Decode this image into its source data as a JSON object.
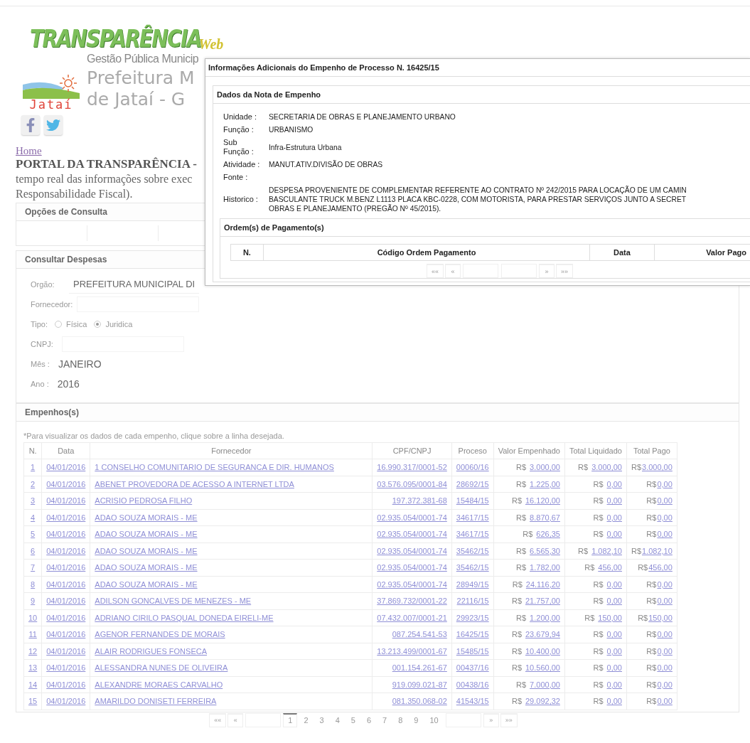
{
  "header": {
    "logo_title": "TRANSPARÊNCIA",
    "logo_suffix": "Web",
    "subtitle": "Gestão Pública Municip",
    "city_logo_text": "Jataí",
    "city_line1": "Prefeitura M",
    "city_line2": "de Jataí - G"
  },
  "home_link": "Home",
  "intro": {
    "title": "PORTAL DA TRANSPARÊNCIA -",
    "line2": "tempo real das informações sobre exec",
    "line3": "Responsabilidade Fiscal)."
  },
  "options_panel": {
    "title": "Opções de Consulta"
  },
  "query_panel": {
    "title": "Consultar Despesas",
    "fields": [
      {
        "kind": "select",
        "label": "Orgão:",
        "value": "PREFEITURA MUNICIPAL DI"
      },
      {
        "kind": "input",
        "label": "Fornecedor:"
      },
      {
        "kind": "radio",
        "label": "Tipo:",
        "options": [
          {
            "label": "Física",
            "selected": false
          },
          {
            "label": "Juridica",
            "selected": true
          }
        ]
      },
      {
        "kind": "input",
        "label": "CNPJ:"
      },
      {
        "kind": "text",
        "label": "Mês :",
        "value": "JANEIRO"
      },
      {
        "kind": "text",
        "label": "Ano :",
        "value": "2016"
      }
    ]
  },
  "empenhos": {
    "title": "Empenhos(s)",
    "note": "*Para visualizar os dados de cada empenho, clique sobre a linha desejada.",
    "columns": [
      "N.",
      "Data",
      "Fornecedor",
      "CPF/CNPJ",
      "Proceso",
      "Valor Empenhado",
      "Total Liquidado",
      "Total Pago"
    ],
    "rows": [
      {
        "n": "1",
        "data": "04/01/2016",
        "fornecedor": "1 CONSELHO COMUNITARIO DE SEGURANCA E DIR. HUMANOS",
        "cpf_cnpj": "16.990.317/0001-52",
        "processo": "00060/16",
        "valor_empenhado": [
          "R$",
          "3.000,00"
        ],
        "total_liquidado": [
          "R$",
          "3.000,00"
        ],
        "total_pago": [
          "R$",
          "3.000,00"
        ]
      },
      {
        "n": "2",
        "data": "04/01/2016",
        "fornecedor": "ABENET PROVEDORA DE ACESSO A INTERNET LTDA",
        "cpf_cnpj": "03.576.095/0001-84",
        "processo": "28692/15",
        "valor_empenhado": [
          "R$",
          "1.225,00"
        ],
        "total_liquidado": [
          "R$",
          "0,00"
        ],
        "total_pago": [
          "R$",
          "0,00"
        ]
      },
      {
        "n": "3",
        "data": "04/01/2016",
        "fornecedor": "ACRISIO PEDROSA FILHO",
        "cpf_cnpj": "197.372.381-68",
        "processo": "15484/15",
        "valor_empenhado": [
          "R$",
          "16.120,00"
        ],
        "total_liquidado": [
          "R$",
          "0,00"
        ],
        "total_pago": [
          "R$",
          "0,00"
        ]
      },
      {
        "n": "4",
        "data": "04/01/2016",
        "fornecedor": "ADAO SOUZA MORAIS - ME",
        "cpf_cnpj": "02.935.054/0001-74",
        "processo": "34617/15",
        "valor_empenhado": [
          "R$",
          "8.870,67"
        ],
        "total_liquidado": [
          "R$",
          "0,00"
        ],
        "total_pago": [
          "R$",
          "0,00"
        ]
      },
      {
        "n": "5",
        "data": "04/01/2016",
        "fornecedor": "ADAO SOUZA MORAIS - ME",
        "cpf_cnpj": "02.935.054/0001-74",
        "processo": "34617/15",
        "valor_empenhado": [
          "R$",
          "626,35"
        ],
        "total_liquidado": [
          "R$",
          "0,00"
        ],
        "total_pago": [
          "R$",
          "0,00"
        ]
      },
      {
        "n": "6",
        "data": "04/01/2016",
        "fornecedor": "ADAO SOUZA MORAIS - ME",
        "cpf_cnpj": "02.935.054/0001-74",
        "processo": "35462/15",
        "valor_empenhado": [
          "R$",
          "6.565,30"
        ],
        "total_liquidado": [
          "R$",
          "1.082,10"
        ],
        "total_pago": [
          "R$",
          "1.082,10"
        ]
      },
      {
        "n": "7",
        "data": "04/01/2016",
        "fornecedor": "ADAO SOUZA MORAIS - ME",
        "cpf_cnpj": "02.935.054/0001-74",
        "processo": "35462/15",
        "valor_empenhado": [
          "R$",
          "1.782,00"
        ],
        "total_liquidado": [
          "R$",
          "456,00"
        ],
        "total_pago": [
          "R$",
          "456,00"
        ]
      },
      {
        "n": "8",
        "data": "04/01/2016",
        "fornecedor": "ADAO SOUZA MORAIS - ME",
        "cpf_cnpj": "02.935.054/0001-74",
        "processo": "28949/15",
        "valor_empenhado": [
          "R$",
          "24.116,20"
        ],
        "total_liquidado": [
          "R$",
          "0,00"
        ],
        "total_pago": [
          "R$",
          "0,00"
        ]
      },
      {
        "n": "9",
        "data": "04/01/2016",
        "fornecedor": "ADILSON GONCALVES DE MENEZES - ME",
        "cpf_cnpj": "37.869.732/0001-22",
        "processo": "22116/15",
        "valor_empenhado": [
          "R$",
          "21.757,00"
        ],
        "total_liquidado": [
          "R$",
          "0,00"
        ],
        "total_pago": [
          "R$",
          "0,00"
        ]
      },
      {
        "n": "10",
        "data": "04/01/2016",
        "fornecedor": "ADRIANO CIRILO PASQUAL DONEDA EIRELI-ME",
        "cpf_cnpj": "07.432.007/0001-21",
        "processo": "29923/15",
        "valor_empenhado": [
          "R$",
          "1.200,00"
        ],
        "total_liquidado": [
          "R$",
          "150,00"
        ],
        "total_pago": [
          "R$",
          "150,00"
        ]
      },
      {
        "n": "11",
        "data": "04/01/2016",
        "fornecedor": "AGENOR FERNANDES DE MORAIS",
        "cpf_cnpj": "087.254.541-53",
        "processo": "16425/15",
        "valor_empenhado": [
          "R$",
          "23.679,94"
        ],
        "total_liquidado": [
          "R$",
          "0,00"
        ],
        "total_pago": [
          "R$",
          "0,00"
        ]
      },
      {
        "n": "12",
        "data": "04/01/2016",
        "fornecedor": "ALAIR RODRIGUES FONSECA",
        "cpf_cnpj": "13.213.499/0001-67",
        "processo": "15485/15",
        "valor_empenhado": [
          "R$",
          "10.400,00"
        ],
        "total_liquidado": [
          "R$",
          "0,00"
        ],
        "total_pago": [
          "R$",
          "0,00"
        ]
      },
      {
        "n": "13",
        "data": "04/01/2016",
        "fornecedor": "ALESSANDRA NUNES DE OLIVEIRA",
        "cpf_cnpj": "001.154.261-67",
        "processo": "00437/16",
        "valor_empenhado": [
          "R$",
          "10.560,00"
        ],
        "total_liquidado": [
          "R$",
          "0,00"
        ],
        "total_pago": [
          "R$",
          "0,00"
        ]
      },
      {
        "n": "14",
        "data": "04/01/2016",
        "fornecedor": "ALEXANDRE MORAES CARVALHO",
        "cpf_cnpj": "919.099.021-87",
        "processo": "00438/16",
        "valor_empenhado": [
          "R$",
          "7.000,00"
        ],
        "total_liquidado": [
          "R$",
          "0,00"
        ],
        "total_pago": [
          "R$",
          "0,00"
        ]
      },
      {
        "n": "15",
        "data": "04/01/2016",
        "fornecedor": "AMARILDO DONISETI FERREIRA",
        "cpf_cnpj": "081.350.068-02",
        "processo": "41543/15",
        "valor_empenhado": [
          "R$",
          "29.092,32"
        ],
        "total_liquidado": [
          "R$",
          "0,00"
        ],
        "total_pago": [
          "R$",
          "0,00"
        ]
      }
    ],
    "pager": [
      {
        "kind": "nav",
        "label": "««"
      },
      {
        "kind": "nav",
        "label": "«"
      },
      {
        "kind": "blank"
      },
      {
        "kind": "page",
        "label": "1",
        "selected": true
      },
      {
        "kind": "page",
        "label": "2",
        "selected": false
      },
      {
        "kind": "page",
        "label": "3",
        "selected": false
      },
      {
        "kind": "page",
        "label": "4",
        "selected": false
      },
      {
        "kind": "page",
        "label": "5",
        "selected": false
      },
      {
        "kind": "page",
        "label": "6",
        "selected": false
      },
      {
        "kind": "page",
        "label": "7",
        "selected": false
      },
      {
        "kind": "page",
        "label": "8",
        "selected": false
      },
      {
        "kind": "page",
        "label": "9",
        "selected": false
      },
      {
        "kind": "page",
        "label": "10",
        "selected": false
      },
      {
        "kind": "blank"
      },
      {
        "kind": "nav",
        "label": "»"
      },
      {
        "kind": "nav",
        "label": "»»"
      }
    ]
  },
  "modal": {
    "title": "Informações Adicionais do Empenho de Processo N. 16425/15",
    "panel_title": "Dados da Nota de Empenho",
    "fields": [
      {
        "label": "Unidade :",
        "value": [
          "SECRETARIA DE OBRAS E PLANEJAMENTO URBANO"
        ]
      },
      {
        "label": "Função :",
        "value": [
          "URBANISMO"
        ]
      },
      {
        "label": "Sub Função :",
        "value": [
          "Infra-Estrutura Urbana"
        ]
      },
      {
        "label": "Atividade :",
        "value": [
          "MANUT.ATIV.DIVISÃO DE OBRAS"
        ]
      },
      {
        "label": "Fonte :"
      },
      {
        "label": "Historico :",
        "value": [
          "DESPESA PROVENIENTE DE COMPLEMENTAR REFERENTE AO CONTRATO Nº 242/2015 PARA LOCAÇÃO DE UM CAMIN",
          "BASCULANTE TRUCK M.BENZ L1113 PLACA KBC-0228, COM MOTORISTA, PARA PRESTAR SERVIÇOS JUNTO A SECRET",
          "OBRAS E PLANEJAMENTO (PREGÃO Nº 45/2015)."
        ]
      }
    ],
    "orders": {
      "title": "Ordem(s) de Pagamento(s)",
      "columns": [
        "N.",
        "Código Ordem Pagamento",
        "Data",
        "Valor Pago"
      ],
      "pager": [
        {
          "kind": "nav",
          "label": "««"
        },
        {
          "kind": "nav",
          "label": "«"
        },
        {
          "kind": "blank"
        },
        {
          "kind": "blank"
        },
        {
          "kind": "nav",
          "label": "»"
        },
        {
          "kind": "nav",
          "label": "»»"
        }
      ]
    }
  }
}
